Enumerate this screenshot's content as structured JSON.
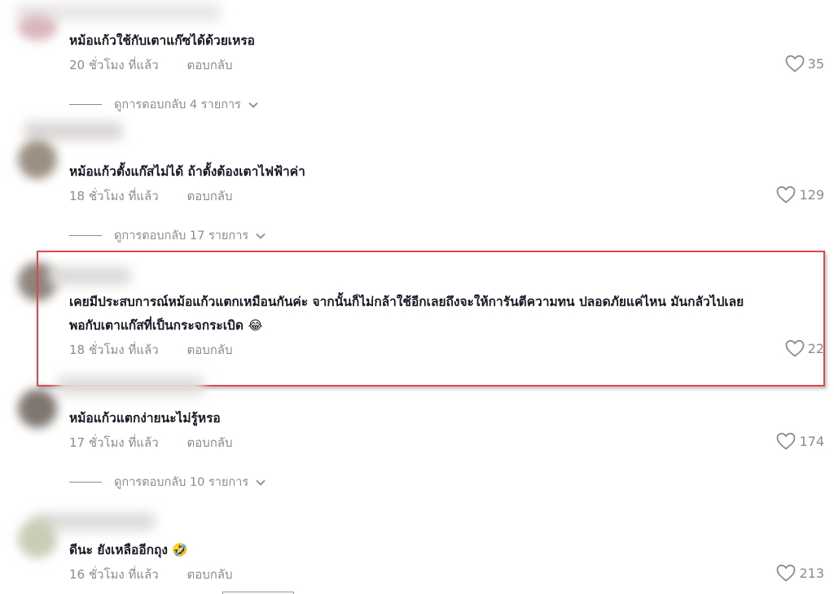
{
  "comments": [
    {
      "text": "หม้อแก้วใช้กับเตาแก๊ซได้ด้วยเหรอ",
      "time": "20 ชั่วโมง ที่แล้ว",
      "reply": "ตอบกลับ",
      "likes": "35",
      "view_replies": "ดูการตอบกลับ 4 รายการ"
    },
    {
      "text": "หม้อแก้วตั้งแก๊สไม่ได้ ถ้าตั้งต้องเตาไฟฟ้าค่า",
      "time": "18 ชั่วโมง ที่แล้ว",
      "reply": "ตอบกลับ",
      "likes": "129",
      "view_replies": "ดูการตอบกลับ 17 รายการ"
    },
    {
      "text_line1": "เคยมีประสบการณ์หม้อแก้วแตกเหมือนกันค่ะ จากนั้นก็ไม่กล้าใช้อีกเลยถึงจะให้การันตีความทน ปลอดภัยแค่ไหน มันกลัวไปเลย",
      "text_line2": "พอกับเตาแก๊สที่เป็นกระจกระเบิด",
      "emoji": "😂",
      "time": "18 ชั่วโมง ที่แล้ว",
      "reply": "ตอบกลับ",
      "likes": "22"
    },
    {
      "text": "หม้อแก้วแตกง่ายนะไม่รู้หรอ",
      "time": "17 ชั่วโมง ที่แล้ว",
      "reply": "ตอบกลับ",
      "likes": "174",
      "view_replies": "ดูการตอบกลับ 10 รายการ"
    },
    {
      "text": "ดีนะ ยังเหลืออีกถุง",
      "emoji": "🤣",
      "time": "16 ชั่วโมง ที่แล้ว",
      "reply": "ตอบกลับ",
      "likes": "213"
    }
  ],
  "icons": {
    "like": "heart-outline-icon",
    "expand": "chevron-down-icon"
  },
  "colors": {
    "text": "#161823",
    "muted": "#8a8b91",
    "highlight_border": "#e0474c"
  }
}
